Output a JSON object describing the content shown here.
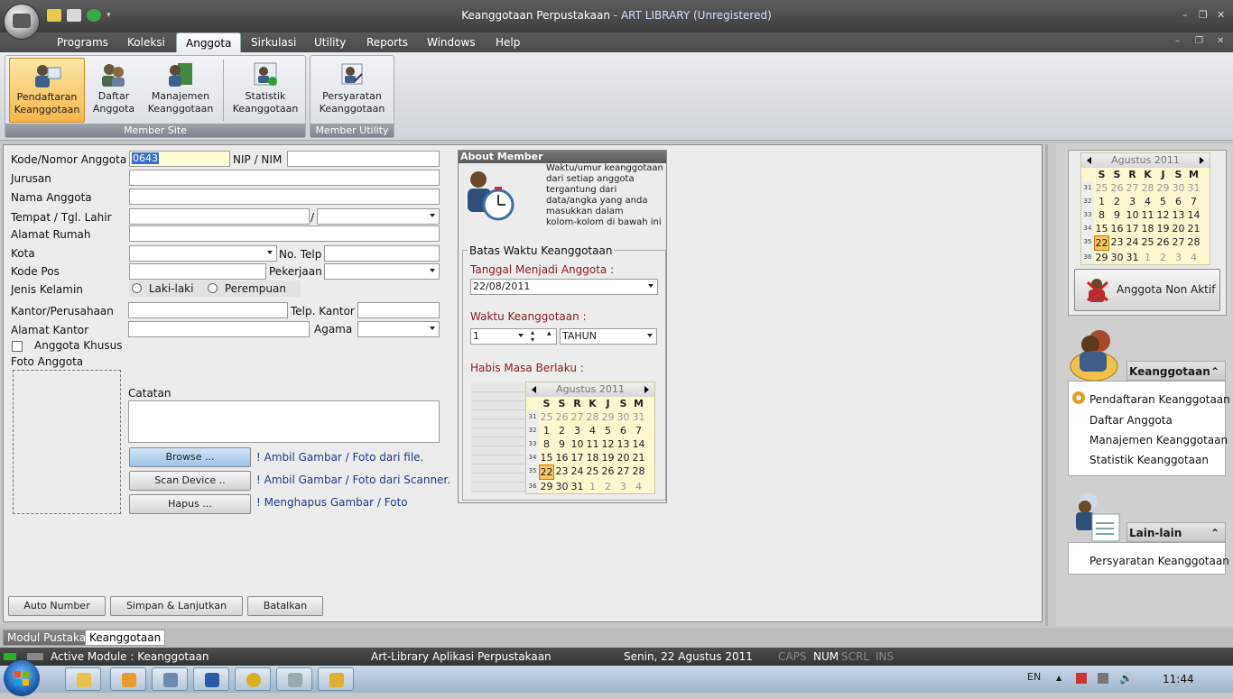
{
  "window": {
    "title": "Keanggotaan Perpustakaan",
    "title_app": "- ART LIBRARY (Unregistered)",
    "minimize": "–",
    "restore": "❐",
    "close": "✕"
  },
  "menu": [
    "Programs",
    "Koleksi",
    "Anggota",
    "Sirkulasi",
    "Utility",
    "Reports",
    "Windows",
    "Help"
  ],
  "ribbon": {
    "group1": {
      "label": "Member Site",
      "buttons": [
        {
          "line1": "Pendaftaran",
          "line2": "Keanggotaan"
        },
        {
          "line1": "Daftar",
          "line2": "Anggota"
        },
        {
          "line1": "Manajemen",
          "line2": "Keanggotaan"
        },
        {
          "line1": "Statistik",
          "line2": "Keanggotaan"
        }
      ]
    },
    "group2": {
      "label": "Member Utility",
      "buttons": [
        {
          "line1": "Persyaratan",
          "line2": "Keanggotaan"
        }
      ]
    }
  },
  "form": {
    "kode_label": "Kode/Nomor Anggota",
    "kode_value": "0643",
    "nip_label": "NIP / NIM",
    "jurusan_label": "Jurusan",
    "nama_label": "Nama Anggota",
    "ttl_label": "Tempat / Tgl. Lahir",
    "ttl_sep": "/",
    "alamat_label": "Alamat Rumah",
    "kota_label": "Kota",
    "telp_label": "No. Telp",
    "kodepos_label": "Kode Pos",
    "pekerjaan_label": "Pekerjaan",
    "jk_label": "Jenis Kelamin",
    "jk_male": "Laki-laki",
    "jk_female": "Perempuan",
    "kantor_label": "Kantor/Perusahaan",
    "telp_kantor_label": "Telp. Kantor",
    "alamat_kantor_label": "Alamat Kantor",
    "agama_label": "Agama",
    "khusus_label": "Anggota Khusus",
    "foto_label": "Foto Anggota",
    "catatan_label": "Catatan",
    "browse": "Browse ...",
    "scan": "Scan Device ..",
    "hapus": "Hapus ...",
    "browse_hint": "! Ambil Gambar / Foto dari file.",
    "scan_hint": "! Ambil Gambar / Foto dari Scanner.",
    "hapus_hint": "! Menghapus Gambar /  Foto",
    "auto_number": "Auto Number",
    "simpan": "Simpan & Lanjutkan",
    "batalkan": "Batalkan"
  },
  "about": {
    "title": "About Member",
    "text": [
      "Waktu/umur keanggotaan",
      "dari setiap anggota",
      "tergantung dari",
      "data/angka yang anda",
      "masukkan dalam",
      "kolom-kolom di bawah ini"
    ],
    "batas_label": "Batas Waktu Keanggotaan",
    "tanggal_label": "Tanggal Menjadi Anggota :",
    "tanggal_value": "22/08/2011",
    "waktu_label": "Waktu Keanggotaan :",
    "waktu_value": "1",
    "waktu_unit": "TAHUN",
    "habis_label": "Habis Masa Berlaku :"
  },
  "calendar": {
    "month": "Agustus 2011",
    "dow": [
      "S",
      "S",
      "R",
      "K",
      "J",
      "S",
      "M"
    ],
    "weeks": [
      {
        "wk": "31",
        "days": [
          [
            "25",
            1
          ],
          [
            "26",
            1
          ],
          [
            "27",
            1
          ],
          [
            "28",
            1
          ],
          [
            "29",
            1
          ],
          [
            "30",
            1
          ],
          [
            "31",
            1
          ]
        ]
      },
      {
        "wk": "32",
        "days": [
          [
            "1",
            0
          ],
          [
            "2",
            0
          ],
          [
            "3",
            0
          ],
          [
            "4",
            0
          ],
          [
            "5",
            0
          ],
          [
            "6",
            0
          ],
          [
            "7",
            0
          ]
        ]
      },
      {
        "wk": "33",
        "days": [
          [
            "8",
            0
          ],
          [
            "9",
            0
          ],
          [
            "10",
            0
          ],
          [
            "11",
            0
          ],
          [
            "12",
            0
          ],
          [
            "13",
            0
          ],
          [
            "14",
            0
          ]
        ]
      },
      {
        "wk": "34",
        "days": [
          [
            "15",
            0
          ],
          [
            "16",
            0
          ],
          [
            "17",
            0
          ],
          [
            "18",
            0
          ],
          [
            "19",
            0
          ],
          [
            "20",
            0
          ],
          [
            "21",
            0
          ]
        ]
      },
      {
        "wk": "35",
        "days": [
          [
            "22",
            2
          ],
          [
            "23",
            0
          ],
          [
            "24",
            0
          ],
          [
            "25",
            0
          ],
          [
            "26",
            0
          ],
          [
            "27",
            0
          ],
          [
            "28",
            0
          ]
        ]
      },
      {
        "wk": "36",
        "days": [
          [
            "29",
            0
          ],
          [
            "30",
            0
          ],
          [
            "31",
            0
          ],
          [
            "1",
            1
          ],
          [
            "2",
            1
          ],
          [
            "3",
            1
          ],
          [
            "4",
            1
          ]
        ]
      }
    ]
  },
  "side": {
    "non_aktif": "Anggota Non Aktif",
    "section1": {
      "title": "Keanggotaan",
      "items": [
        "Pendaftaran Keanggotaan",
        "Daftar Anggota",
        "Manajemen Keanggotaan",
        "Statistik Keanggotaan"
      ]
    },
    "section2": {
      "title": "Lain-lain",
      "items": [
        "Persyaratan Keanggotaan"
      ]
    }
  },
  "tabs": [
    "Modul Pustaka",
    "Keanggotaan"
  ],
  "status": {
    "active_module": "Active Module : Keanggotaan",
    "app": "Art-Library Aplikasi Perpustakaan",
    "date": "Senin, 22 Agustus 2011",
    "caps": "CAPS",
    "num": "NUM",
    "scrl": "SCRL",
    "ins": "INS"
  },
  "taskbar": {
    "lang": "EN",
    "time": "11:44"
  }
}
